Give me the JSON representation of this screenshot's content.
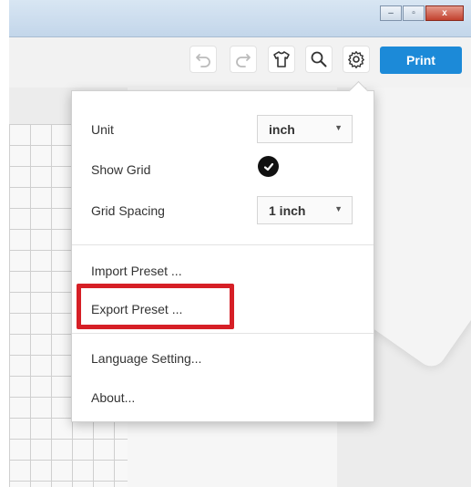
{
  "window": {
    "minimize_glyph": "–",
    "maximize_glyph": "▫",
    "close_glyph": "x"
  },
  "toolbar": {
    "icons": [
      "undo-icon",
      "redo-icon",
      "tshirt-icon",
      "search-icon",
      "gear-icon"
    ],
    "print_label": "Print",
    "print_color": "#1c8ad8"
  },
  "settings_menu": {
    "unit_label": "Unit",
    "unit_value": "inch",
    "show_grid_label": "Show Grid",
    "show_grid_checked": true,
    "grid_spacing_label": "Grid Spacing",
    "grid_spacing_value": "1 inch",
    "import_preset": "Import Preset ...",
    "export_preset": "Export Preset ...",
    "language_setting": "Language Setting...",
    "about": "About..."
  },
  "highlight_color": "#d61f26"
}
